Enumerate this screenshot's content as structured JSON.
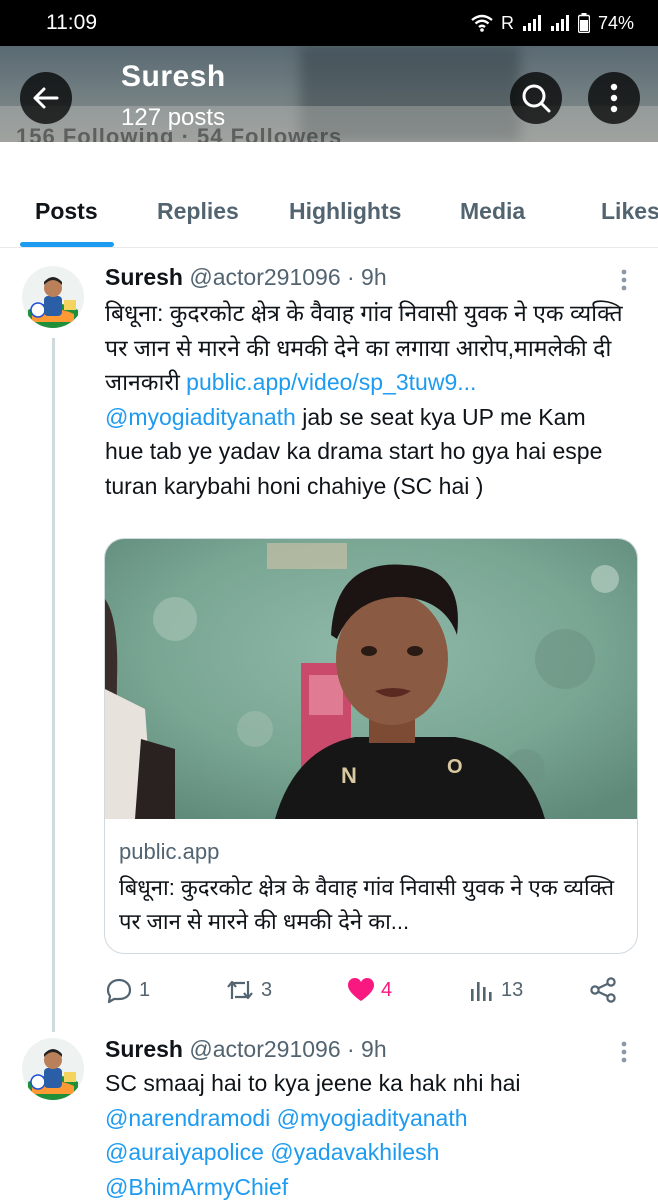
{
  "status_bar": {
    "time": "11:09",
    "network_label": "R",
    "battery": "74%",
    "icons": [
      "wifi-icon",
      "signal-icon",
      "signal-icon",
      "battery-icon"
    ]
  },
  "header": {
    "title": "Suresh",
    "subtitle": "127 posts",
    "behind_text": "156 Following · 54 Followers",
    "icons": [
      "back-arrow-icon",
      "search-icon",
      "more-vertical-icon"
    ]
  },
  "tabs": [
    {
      "label": "Posts",
      "active": true
    },
    {
      "label": "Replies",
      "active": false
    },
    {
      "label": "Highlights",
      "active": false
    },
    {
      "label": "Media",
      "active": false
    },
    {
      "label": "Likes",
      "active": false
    }
  ],
  "tweets": [
    {
      "name": "Suresh",
      "meta": "@actor291096 · 9h",
      "quote_text": "बिधूना: कुदरकोट क्षेत्र के वैवाह गांव निवासी युवक ने एक व्यक्ति पर जान से मारने की धमकी देने का लगाया आरोप,मामलेकी दी जानकारी ",
      "quote_link": "public.app/video/sp_3tuw9...",
      "mention": "@myogiadityanath",
      "body_text": " jab se seat kya UP me Kam hue tab ye yadav ka drama start ho gya hai espe turan karybahi honi chahiye (SC hai )",
      "card": {
        "domain": "public.app",
        "title": "बिधूना: कुदरकोट क्षेत्र के वैवाह गांव निवासी युवक ने एक व्यक्ति पर जान से मारने की धमकी देने का..."
      },
      "actions": {
        "replies": "1",
        "reposts": "3",
        "likes": "4",
        "views": "13"
      }
    },
    {
      "name": "Suresh",
      "meta": "@actor291096 · 9h",
      "text": "SC smaaj hai to kya jeene ka hak nhi hai",
      "mentions_line1": "@narendramodi @myogiadityanath",
      "mentions_line2": "@auraiyapolice @yadavakhilesh",
      "mentions_line3": "@BhimArmyChief"
    }
  ],
  "colors": {
    "accent": "#1d9bf0",
    "like": "#f91880",
    "secondary_text": "#536471"
  }
}
